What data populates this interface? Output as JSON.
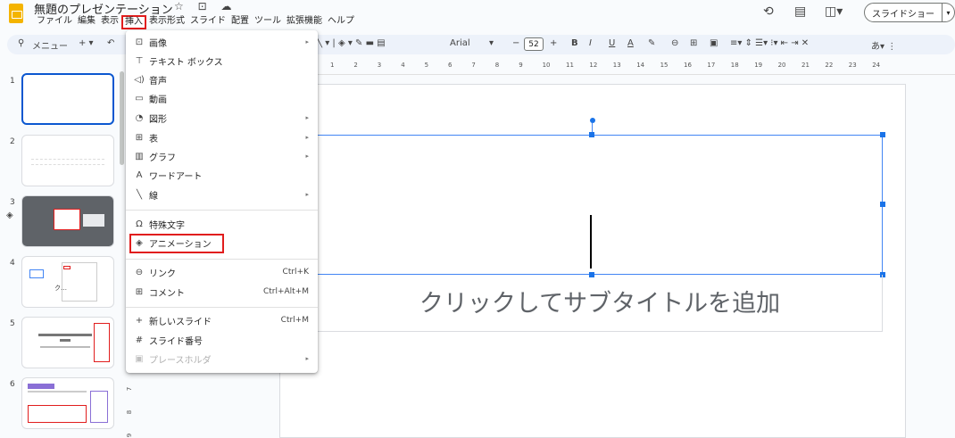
{
  "header": {
    "doc_title": "無題のプレゼンテーション",
    "title_icons": "☆ ⊡ ☁",
    "menus": [
      "ファイル",
      "編集",
      "表示",
      "挿入",
      "表示形式",
      "スライド",
      "配置",
      "ツール",
      "拡張機能",
      "ヘルプ"
    ],
    "active_menu": "挿入",
    "slideshow_label": "スライドショー",
    "icons": [
      "history-icon",
      "comment-icon",
      "meet-icon"
    ]
  },
  "toolbar": {
    "menu_search": "メニュー",
    "font_name": "Arial",
    "font_size": "52",
    "undo_icon": "↶"
  },
  "filmstrip": {
    "slides": [
      {
        "num": "1"
      },
      {
        "num": "2"
      },
      {
        "num": "3"
      },
      {
        "num": "4"
      },
      {
        "num": "5"
      },
      {
        "num": "6"
      }
    ]
  },
  "ruler": {
    "ticks": [
      "1",
      "2",
      "3",
      "4",
      "5",
      "6",
      "7",
      "8",
      "9",
      "10",
      "11",
      "12",
      "13",
      "14",
      "15",
      "16",
      "17",
      "18",
      "19",
      "20",
      "21",
      "22",
      "23",
      "24"
    ]
  },
  "slide": {
    "subtitle_placeholder": "クリックしてサブタイトルを追加"
  },
  "insert_menu": {
    "items": [
      {
        "label": "画像",
        "icon": "⊡",
        "submenu": true
      },
      {
        "label": "テキスト ボックス",
        "icon": "⊤"
      },
      {
        "label": "音声",
        "icon": "◁)"
      },
      {
        "label": "動画",
        "icon": "▭"
      },
      {
        "label": "図形",
        "icon": "◔",
        "submenu": true
      },
      {
        "label": "表",
        "icon": "⊞",
        "submenu": true
      },
      {
        "label": "グラフ",
        "icon": "▥",
        "submenu": true
      },
      {
        "label": "ワードアート",
        "icon": "A"
      },
      {
        "label": "線",
        "icon": "╲",
        "submenu": true
      },
      {
        "label": "特殊文字",
        "icon": "Ω"
      },
      {
        "label": "アニメーション",
        "icon": "◈"
      },
      {
        "label": "リンク",
        "icon": "⊖",
        "shortcut": "Ctrl+K"
      },
      {
        "label": "コメント",
        "icon": "⊞",
        "shortcut": "Ctrl+Alt+M"
      },
      {
        "label": "新しいスライド",
        "icon": "+",
        "shortcut": "Ctrl+M"
      },
      {
        "label": "スライド番号",
        "icon": "#"
      },
      {
        "label": "プレースホルダ",
        "icon": "▣",
        "submenu": true,
        "disabled": true
      }
    ],
    "highlighted": "アニメーション"
  }
}
